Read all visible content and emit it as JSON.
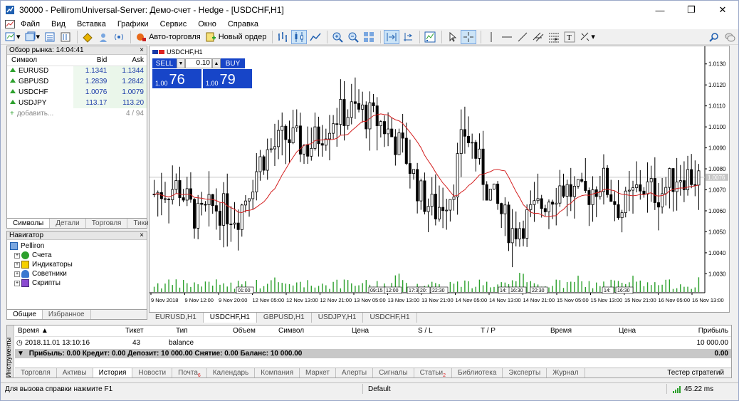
{
  "window": {
    "title": "30000 - PelliromUniversal-Server: Демо-счет - Hedge - [USDCHF,H1]"
  },
  "menu": [
    "Файл",
    "Вид",
    "Вставка",
    "Графики",
    "Сервис",
    "Окно",
    "Справка"
  ],
  "toolbar": {
    "auto_trading": "Авто-торговля",
    "new_order": "Новый ордер"
  },
  "market_watch": {
    "title": "Обзор рынка: 14:04:41",
    "headers": [
      "Символ",
      "Bid",
      "Ask"
    ],
    "rows": [
      {
        "symbol": "EURUSD",
        "bid": "1.1341",
        "ask": "1.1344"
      },
      {
        "symbol": "GBPUSD",
        "bid": "1.2839",
        "ask": "1.2842"
      },
      {
        "symbol": "USDCHF",
        "bid": "1.0076",
        "ask": "1.0079"
      },
      {
        "symbol": "USDJPY",
        "bid": "113.17",
        "ask": "113.20"
      }
    ],
    "add_label": "добавить...",
    "count": "4 / 94",
    "tabs": [
      "Символы",
      "Детали",
      "Торговля",
      "Тики"
    ]
  },
  "navigator": {
    "title": "Навигатор",
    "root": "Pelliron",
    "items": [
      "Счета",
      "Индикаторы",
      "Советники",
      "Скрипты"
    ],
    "tabs": [
      "Общие",
      "Избранное"
    ]
  },
  "chart": {
    "symbol_label": "USDCHF,H1",
    "sell_label": "SELL",
    "buy_label": "BUY",
    "volume": "0.10",
    "sell_small": "1.00",
    "sell_big": "76",
    "buy_small": "1.00",
    "buy_big": "79",
    "current_price": "1.0076",
    "price_ticks": [
      "1.0130",
      "1.0120",
      "1.0110",
      "1.0100",
      "1.0090",
      "1.0080",
      "1.0070",
      "1.0060",
      "1.0050",
      "1.0040",
      "1.0030"
    ],
    "time_ticks": [
      "9 Nov 2018",
      "9 Nov 12:00",
      "9 Nov 20:00",
      "12 Nov 05:00",
      "12 Nov 13:00",
      "12 Nov 21:00",
      "13 Nov 05:00",
      "13 Nov 13:00",
      "13 Nov 21:00",
      "14 Nov 05:00",
      "14 Nov 13:00",
      "14 Nov 21:00",
      "15 Nov 05:00",
      "15 Nov 13:00",
      "15 Nov 21:00",
      "16 Nov 05:00",
      "16 Nov 13:00"
    ],
    "gap_marks": [
      "01:00",
      "09:15",
      "12:00",
      "17:30",
      "20:",
      "22:30",
      "14:",
      "16:30",
      "22:30",
      "14:",
      "16:30"
    ],
    "tabs": [
      "EURUSD,H1",
      "USDCHF,H1",
      "GBPUSD,H1",
      "USDJPY,H1",
      "USDCHF,H1"
    ],
    "colors": {
      "ma": "#d42020",
      "up": "#000000",
      "down": "#000000",
      "volume": "#2ca02c",
      "panel": "#1745c8"
    }
  },
  "terminal": {
    "side_label": "Инструменты",
    "headers": {
      "time": "Время",
      "ticket": "Тикет",
      "type": "Тип",
      "volume": "Объем",
      "symbol": "Символ",
      "price": "Цена",
      "sl": "S / L",
      "tp": "T / P",
      "time2": "Время",
      "price2": "Цена",
      "profit": "Прибыль"
    },
    "row": {
      "time": "2018.11.01 13:10:16",
      "ticket": "43",
      "type": "balance",
      "profit": "10 000.00"
    },
    "balance_line": "Прибыль: 0.00  Кредит: 0.00  Депозит: 10 000.00  Снятие: 0.00  Баланс: 10 000.00",
    "balance_total": "0.00",
    "tabs": [
      {
        "label": "Торговля"
      },
      {
        "label": "Активы"
      },
      {
        "label": "История"
      },
      {
        "label": "Новости"
      },
      {
        "label": "Почта",
        "badge": "6"
      },
      {
        "label": "Календарь"
      },
      {
        "label": "Компания"
      },
      {
        "label": "Маркет"
      },
      {
        "label": "Алерты"
      },
      {
        "label": "Сигналы"
      },
      {
        "label": "Статьи",
        "badge": "2"
      },
      {
        "label": "Библиотека"
      },
      {
        "label": "Эксперты"
      },
      {
        "label": "Журнал"
      }
    ],
    "strategy_tester": "Тестер стратегий"
  },
  "status": {
    "help": "Для вызова справки нажмите F1",
    "profile": "Default",
    "ping": "45.22 ms"
  }
}
